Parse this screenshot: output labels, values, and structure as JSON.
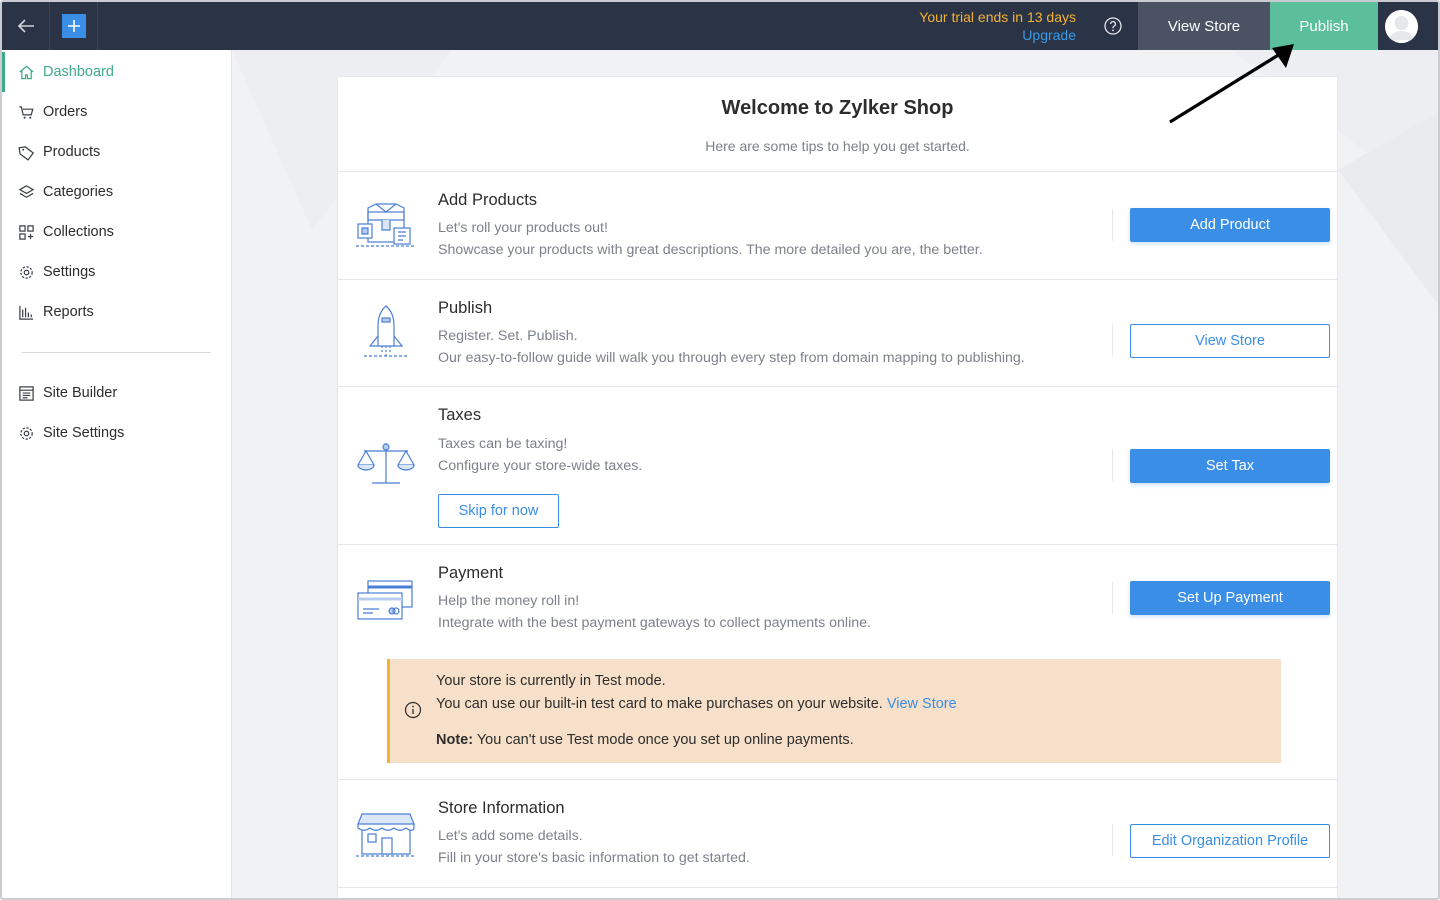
{
  "topbar": {
    "trial_text": "Your trial ends in 13 days",
    "upgrade_label": "Upgrade",
    "view_store_label": "View Store",
    "publish_label": "Publish"
  },
  "sidebar": {
    "items": [
      {
        "label": "Dashboard",
        "icon": "home-icon",
        "active": true
      },
      {
        "label": "Orders",
        "icon": "cart-icon"
      },
      {
        "label": "Products",
        "icon": "tag-icon"
      },
      {
        "label": "Categories",
        "icon": "layers-icon"
      },
      {
        "label": "Collections",
        "icon": "grid-icon"
      },
      {
        "label": "Settings",
        "icon": "gear-icon"
      },
      {
        "label": "Reports",
        "icon": "bar-chart-icon"
      }
    ],
    "bottom_items": [
      {
        "label": "Site Builder",
        "icon": "site-builder-icon"
      },
      {
        "label": "Site Settings",
        "icon": "gear-icon"
      }
    ]
  },
  "welcome": {
    "title": "Welcome to Zylker Shop",
    "subtitle": "Here are some tips to help you get started."
  },
  "steps": {
    "add_products": {
      "title": "Add Products",
      "line1": "Let's roll your products out!",
      "line2": "Showcase your products with great descriptions. The more detailed you are, the better.",
      "button": "Add Product"
    },
    "publish": {
      "title": "Publish",
      "line1": "Register. Set. Publish.",
      "line2": "Our easy-to-follow guide will walk you through every step from domain mapping to publishing.",
      "button": "View Store"
    },
    "taxes": {
      "title": "Taxes",
      "line1": "Taxes can be taxing!",
      "line2": "Configure your store-wide taxes.",
      "skip_button": "Skip for now",
      "button": "Set Tax"
    },
    "payment": {
      "title": "Payment",
      "line1": "Help the money roll in!",
      "line2": "Integrate with the best payment gateways to collect payments online.",
      "button": "Set Up Payment",
      "notice": {
        "line1": "Your store is currently in Test mode.",
        "line2": "You can use our built-in test card to make purchases on your website.",
        "link": "View Store",
        "note_label": "Note:",
        "note_text": "You can't use Test mode once you set up online payments."
      }
    },
    "store_info": {
      "title": "Store Information",
      "line1": "Let's add some details.",
      "line2": "Fill in your store's basic information to get started.",
      "button": "Edit Organization Profile"
    }
  },
  "colors": {
    "topbar": "#2b3446",
    "accent_blue": "#3a8ee6",
    "publish_green": "#5cbf9b",
    "active_green": "#3fa98a",
    "trial_yellow": "#f2b233",
    "notice_bg": "#f7e0c9"
  }
}
